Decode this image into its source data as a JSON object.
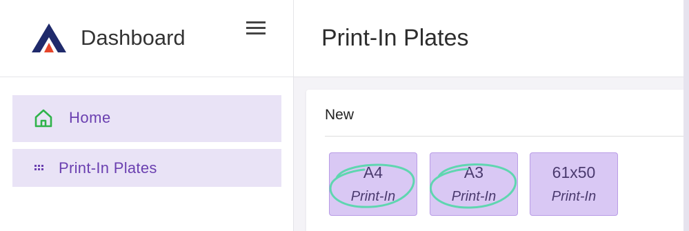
{
  "sidebar": {
    "brand": "Dashboard",
    "items": [
      {
        "label": "Home",
        "icon": "home-icon"
      },
      {
        "label": "Print-In Plates",
        "icon": "grid-icon"
      }
    ]
  },
  "header": {
    "title": "Print-In Plates"
  },
  "card": {
    "title": "New",
    "plates": [
      {
        "size": "A4",
        "type": "Print-In"
      },
      {
        "size": "A3",
        "type": "Print-In"
      },
      {
        "size": "61x50",
        "type": "Print-In"
      }
    ]
  },
  "colors": {
    "accent": "#6a3fb0",
    "nav_bg": "#e9e3f6",
    "plate_bg": "#d9c8f4",
    "annotation": "#5fd6b0"
  }
}
